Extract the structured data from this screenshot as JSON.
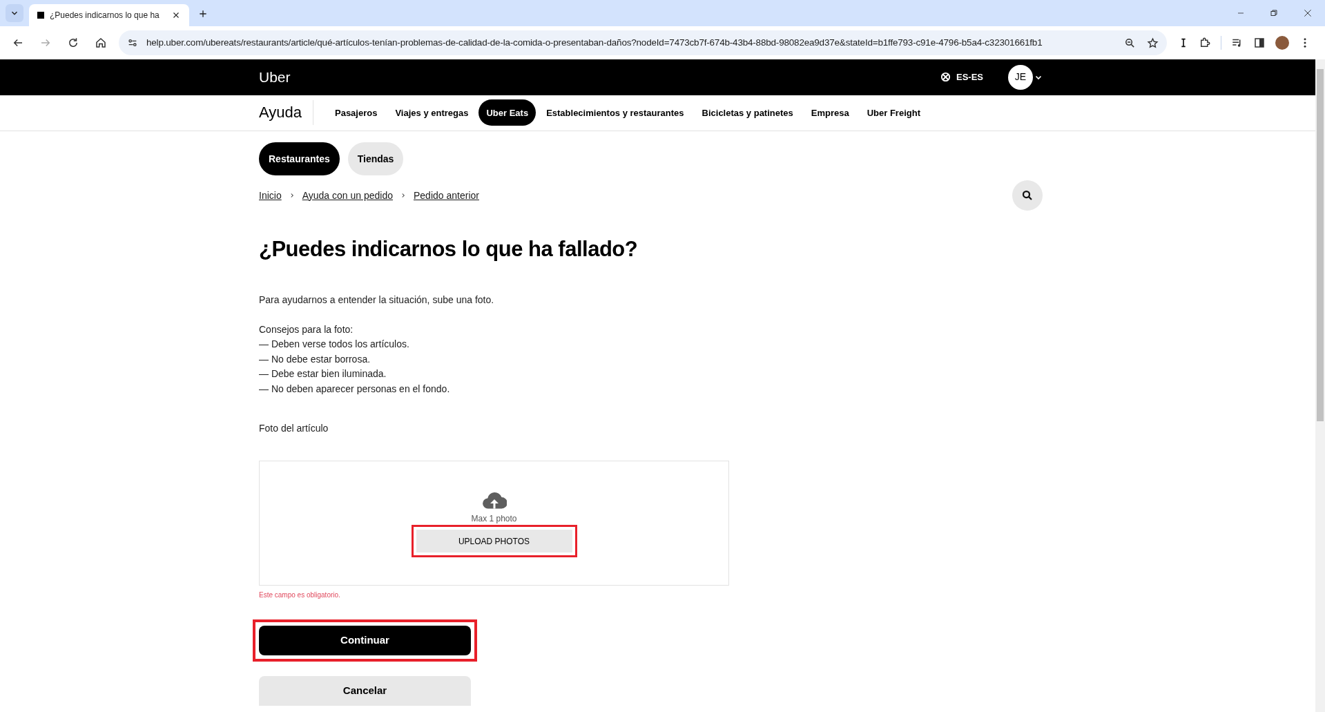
{
  "browser": {
    "tab_title": "¿Puedes indicarnos lo que ha",
    "url": "help.uber.com/ubereats/restaurants/article/qué-artículos-tenían-problemas-de-calidad-de-la-comida-o-presentaban-daños?nodeId=7473cb7f-674b-43b4-88bd-98082ea9d37e&stateId=b1ffe793-c91e-4796-b5a4-c32301661fb1"
  },
  "header": {
    "logo": "Uber",
    "language": "ES-ES",
    "avatar": "JE"
  },
  "nav": {
    "title": "Ayuda",
    "items": [
      {
        "label": "Pasajeros",
        "selected": false
      },
      {
        "label": "Viajes y entregas",
        "selected": false
      },
      {
        "label": "Uber Eats",
        "selected": true
      },
      {
        "label": "Establecimientos y restaurantes",
        "selected": false
      },
      {
        "label": "Bicicletas y patinetes",
        "selected": false
      },
      {
        "label": "Empresa",
        "selected": false
      },
      {
        "label": "Uber Freight",
        "selected": false
      }
    ]
  },
  "subtabs": [
    {
      "label": "Restaurantes",
      "selected": true
    },
    {
      "label": "Tiendas",
      "selected": false
    }
  ],
  "breadcrumbs": [
    "Inicio",
    "Ayuda con un pedido",
    "Pedido anterior"
  ],
  "heading": "¿Puedes indicarnos lo que ha fallado?",
  "intro": "Para ayudarnos a entender la situación, sube una foto.",
  "tips_title": "Consejos para la foto:",
  "tips": [
    "— Deben verse todos los artículos.",
    "— No debe estar borrosa.",
    "— Debe estar bien iluminada.",
    "— No deben aparecer personas en el fondo."
  ],
  "upload": {
    "label": "Foto del artículo",
    "hint": "Max 1 photo",
    "button": "UPLOAD PHOTOS",
    "highlighted": true,
    "error": "Este campo es obligatorio."
  },
  "buttons": [
    {
      "label": "Continuar",
      "kind": "primary",
      "highlighted": true
    },
    {
      "label": "Cancelar",
      "kind": "secondary",
      "highlighted": false
    }
  ]
}
